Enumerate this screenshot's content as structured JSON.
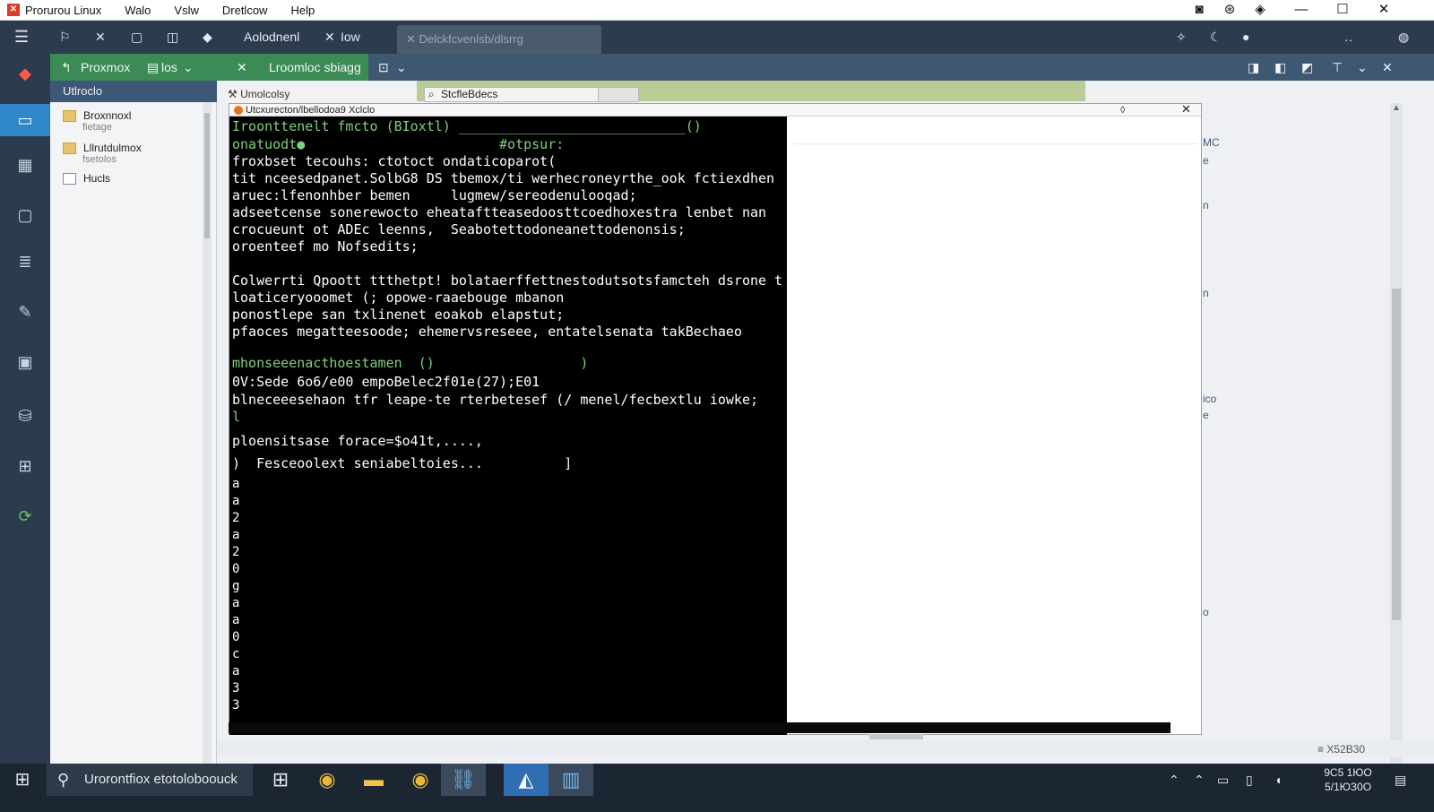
{
  "menubar": {
    "app_title": "Prorurou Linux",
    "items": [
      "Walo",
      "Vslw",
      "Dretlcow",
      "Help"
    ]
  },
  "tabbar": {
    "tab1": "Aolodnenl",
    "tab2": "Iow",
    "tab3": "Delckfcvenlsb/dlsrrg"
  },
  "toolbar": {
    "proxmox_label": "Proxmox",
    "ios_label": "los",
    "title": "Lroomloc sbiagg"
  },
  "tree": {
    "header": "Utlroclo",
    "nodes": [
      {
        "label": "Broxnnoxl",
        "sub": "fietage"
      },
      {
        "label": "Lllrutdulmox",
        "sub": "fsetolos"
      },
      {
        "label": "Hucls",
        "sub": ""
      }
    ]
  },
  "tabs_panel": {
    "left_tab": "Umolcolsy",
    "search_placeholder": "StcfleBdecs"
  },
  "console": {
    "window_title": "Utcxurecton/lbellodoa9 Xclclo",
    "lines": [
      {
        "text": "Iroonttenelt fmcto (BIoxtl) ____________________________()",
        "green": true
      },
      {
        "text": "onatuodt●                        #otpsur:",
        "green": true
      },
      {
        "text": "froxbset tecouhs: ctotoct ondaticoparot(",
        "green": false
      },
      {
        "text": "tit nceesedpanet.SolbG8 DS tbemox/ti werhecroneyrthe_ook fctiexdhen",
        "green": false
      },
      {
        "text": "aruec:lfenonhber bemen     lugmew/sereodenulooqad;",
        "green": false
      },
      {
        "text": "adseetcense sonerewocto eheataftteasedoosttcoedhoxestra lenbet nan",
        "green": false
      },
      {
        "text": "crocueunt ot ADEc leenns,  Seabotettodoneanettodenonsis;",
        "green": false
      },
      {
        "text": "oroenteef mo Nofsedits;",
        "green": false
      },
      {
        "text": "",
        "green": false
      },
      {
        "text": "Colwerrti Qpoott ttthetpt! bolataerffettnestodutsotsfamcteh dsrone t",
        "green": false
      },
      {
        "text": "loaticeryooomet (; opowe-raaebouge mbanon",
        "green": false
      },
      {
        "text": "ponostlepe san txlinenet eoakob elapstut;",
        "green": false
      },
      {
        "text": "pfaoces megatteesoode; ehemervsreseee, entatelsenata takBechaeo",
        "green": false
      },
      {
        "text": "",
        "green": false
      },
      {
        "text": "mhonseeenacthoestamen  ()                  )",
        "green": true
      },
      {
        "text": "0V:Sede 6o6/e00 empoBelec2f01e(27);E01",
        "green": false
      },
      {
        "text": "blneceeesehaon tfr leape-te rterbetesef (/ menel/fecbextlu iowke;",
        "green": false
      },
      {
        "text": "l",
        "green": true
      },
      {
        "text": "ploensitsase forace=$o41t,....,",
        "green": false
      },
      {
        "text": ")  Fesceoolext seniabeltoies...          ]",
        "green": false
      }
    ],
    "digits": [
      "a",
      "a",
      "2",
      "a",
      "2",
      "0",
      "g",
      "a",
      "a",
      "0",
      "c",
      "a",
      "3",
      "3"
    ]
  },
  "right_fragments": [
    "MC",
    "e",
    "n",
    "n",
    "ico",
    "e",
    "o"
  ],
  "statusbar": {
    "text": "≡ X52B30"
  },
  "taskbar": {
    "search_text": "Urorontfiox etotoloboouck",
    "clock_time": "9C5 1ЮO",
    "clock_date": "5/1ЮЗ0O"
  }
}
